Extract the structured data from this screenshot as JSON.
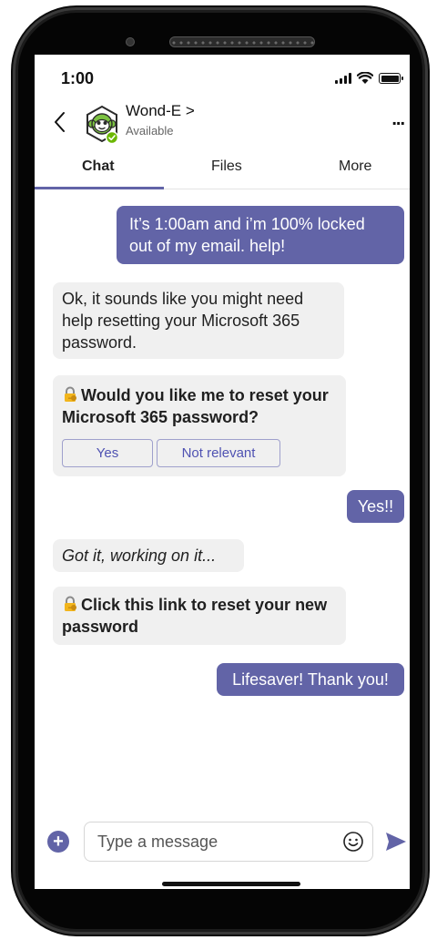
{
  "status_bar": {
    "time": "1:00"
  },
  "header": {
    "contact_name": "Wond-E",
    "name_chevron": ">",
    "presence": "Available",
    "more": "..."
  },
  "tabs": [
    {
      "label": "Chat",
      "active": true
    },
    {
      "label": "Files",
      "active": false
    },
    {
      "label": "More",
      "active": false
    }
  ],
  "messages": [
    {
      "direction": "outgoing",
      "text": "It’s 1:00am and i’m 100% locked out of my email. help!"
    },
    {
      "direction": "incoming",
      "text": "Ok, it sounds like you might need help resetting your Microsoft 365 password."
    },
    {
      "direction": "incoming",
      "type": "card",
      "title": "Would you like me to reset your Microsoft 365 password?",
      "icon": "lock-key-icon",
      "buttons": [
        "Yes",
        "Not relevant"
      ]
    },
    {
      "direction": "outgoing",
      "text": "Yes!!"
    },
    {
      "direction": "incoming",
      "text": "Got it, working on it..."
    },
    {
      "direction": "incoming",
      "type": "link",
      "icon": "lock-key-icon",
      "text": "Click this link to reset your new password"
    },
    {
      "direction": "outgoing",
      "text": "Lifesaver! Thank you!"
    }
  ],
  "composer": {
    "placeholder": "Type a message",
    "add_label": "+"
  },
  "colors": {
    "accent": "#6264a7",
    "link": "#4f52b2",
    "incoming_bubble": "#f0f0f0",
    "presence_available": "#6bb700",
    "avatar_green": "#7cc242"
  }
}
